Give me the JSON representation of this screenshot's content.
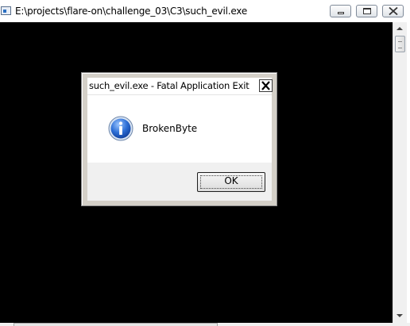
{
  "window": {
    "title": "E:\\projects\\flare-on\\challenge_03\\C3\\such_evil.exe",
    "icon": "console-app-icon",
    "background_color": "#000000"
  },
  "dialog": {
    "title": "such_evil.exe - Fatal Application Exit",
    "icon": "information-icon",
    "message": "BrokenByte",
    "ok_label": "OK"
  }
}
